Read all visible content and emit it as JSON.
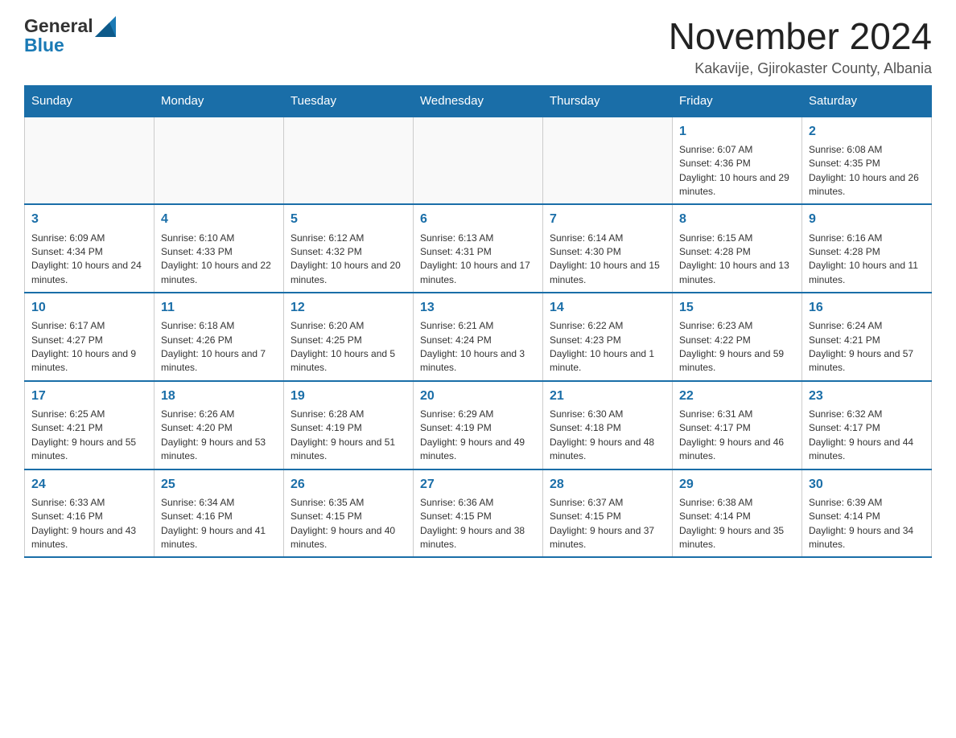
{
  "header": {
    "logo_general": "General",
    "logo_blue": "Blue",
    "month_title": "November 2024",
    "subtitle": "Kakavije, Gjirokaster County, Albania"
  },
  "weekdays": [
    "Sunday",
    "Monday",
    "Tuesday",
    "Wednesday",
    "Thursday",
    "Friday",
    "Saturday"
  ],
  "weeks": [
    [
      {
        "day": "",
        "info": ""
      },
      {
        "day": "",
        "info": ""
      },
      {
        "day": "",
        "info": ""
      },
      {
        "day": "",
        "info": ""
      },
      {
        "day": "",
        "info": ""
      },
      {
        "day": "1",
        "info": "Sunrise: 6:07 AM\nSunset: 4:36 PM\nDaylight: 10 hours and 29 minutes."
      },
      {
        "day": "2",
        "info": "Sunrise: 6:08 AM\nSunset: 4:35 PM\nDaylight: 10 hours and 26 minutes."
      }
    ],
    [
      {
        "day": "3",
        "info": "Sunrise: 6:09 AM\nSunset: 4:34 PM\nDaylight: 10 hours and 24 minutes."
      },
      {
        "day": "4",
        "info": "Sunrise: 6:10 AM\nSunset: 4:33 PM\nDaylight: 10 hours and 22 minutes."
      },
      {
        "day": "5",
        "info": "Sunrise: 6:12 AM\nSunset: 4:32 PM\nDaylight: 10 hours and 20 minutes."
      },
      {
        "day": "6",
        "info": "Sunrise: 6:13 AM\nSunset: 4:31 PM\nDaylight: 10 hours and 17 minutes."
      },
      {
        "day": "7",
        "info": "Sunrise: 6:14 AM\nSunset: 4:30 PM\nDaylight: 10 hours and 15 minutes."
      },
      {
        "day": "8",
        "info": "Sunrise: 6:15 AM\nSunset: 4:28 PM\nDaylight: 10 hours and 13 minutes."
      },
      {
        "day": "9",
        "info": "Sunrise: 6:16 AM\nSunset: 4:28 PM\nDaylight: 10 hours and 11 minutes."
      }
    ],
    [
      {
        "day": "10",
        "info": "Sunrise: 6:17 AM\nSunset: 4:27 PM\nDaylight: 10 hours and 9 minutes."
      },
      {
        "day": "11",
        "info": "Sunrise: 6:18 AM\nSunset: 4:26 PM\nDaylight: 10 hours and 7 minutes."
      },
      {
        "day": "12",
        "info": "Sunrise: 6:20 AM\nSunset: 4:25 PM\nDaylight: 10 hours and 5 minutes."
      },
      {
        "day": "13",
        "info": "Sunrise: 6:21 AM\nSunset: 4:24 PM\nDaylight: 10 hours and 3 minutes."
      },
      {
        "day": "14",
        "info": "Sunrise: 6:22 AM\nSunset: 4:23 PM\nDaylight: 10 hours and 1 minute."
      },
      {
        "day": "15",
        "info": "Sunrise: 6:23 AM\nSunset: 4:22 PM\nDaylight: 9 hours and 59 minutes."
      },
      {
        "day": "16",
        "info": "Sunrise: 6:24 AM\nSunset: 4:21 PM\nDaylight: 9 hours and 57 minutes."
      }
    ],
    [
      {
        "day": "17",
        "info": "Sunrise: 6:25 AM\nSunset: 4:21 PM\nDaylight: 9 hours and 55 minutes."
      },
      {
        "day": "18",
        "info": "Sunrise: 6:26 AM\nSunset: 4:20 PM\nDaylight: 9 hours and 53 minutes."
      },
      {
        "day": "19",
        "info": "Sunrise: 6:28 AM\nSunset: 4:19 PM\nDaylight: 9 hours and 51 minutes."
      },
      {
        "day": "20",
        "info": "Sunrise: 6:29 AM\nSunset: 4:19 PM\nDaylight: 9 hours and 49 minutes."
      },
      {
        "day": "21",
        "info": "Sunrise: 6:30 AM\nSunset: 4:18 PM\nDaylight: 9 hours and 48 minutes."
      },
      {
        "day": "22",
        "info": "Sunrise: 6:31 AM\nSunset: 4:17 PM\nDaylight: 9 hours and 46 minutes."
      },
      {
        "day": "23",
        "info": "Sunrise: 6:32 AM\nSunset: 4:17 PM\nDaylight: 9 hours and 44 minutes."
      }
    ],
    [
      {
        "day": "24",
        "info": "Sunrise: 6:33 AM\nSunset: 4:16 PM\nDaylight: 9 hours and 43 minutes."
      },
      {
        "day": "25",
        "info": "Sunrise: 6:34 AM\nSunset: 4:16 PM\nDaylight: 9 hours and 41 minutes."
      },
      {
        "day": "26",
        "info": "Sunrise: 6:35 AM\nSunset: 4:15 PM\nDaylight: 9 hours and 40 minutes."
      },
      {
        "day": "27",
        "info": "Sunrise: 6:36 AM\nSunset: 4:15 PM\nDaylight: 9 hours and 38 minutes."
      },
      {
        "day": "28",
        "info": "Sunrise: 6:37 AM\nSunset: 4:15 PM\nDaylight: 9 hours and 37 minutes."
      },
      {
        "day": "29",
        "info": "Sunrise: 6:38 AM\nSunset: 4:14 PM\nDaylight: 9 hours and 35 minutes."
      },
      {
        "day": "30",
        "info": "Sunrise: 6:39 AM\nSunset: 4:14 PM\nDaylight: 9 hours and 34 minutes."
      }
    ]
  ]
}
